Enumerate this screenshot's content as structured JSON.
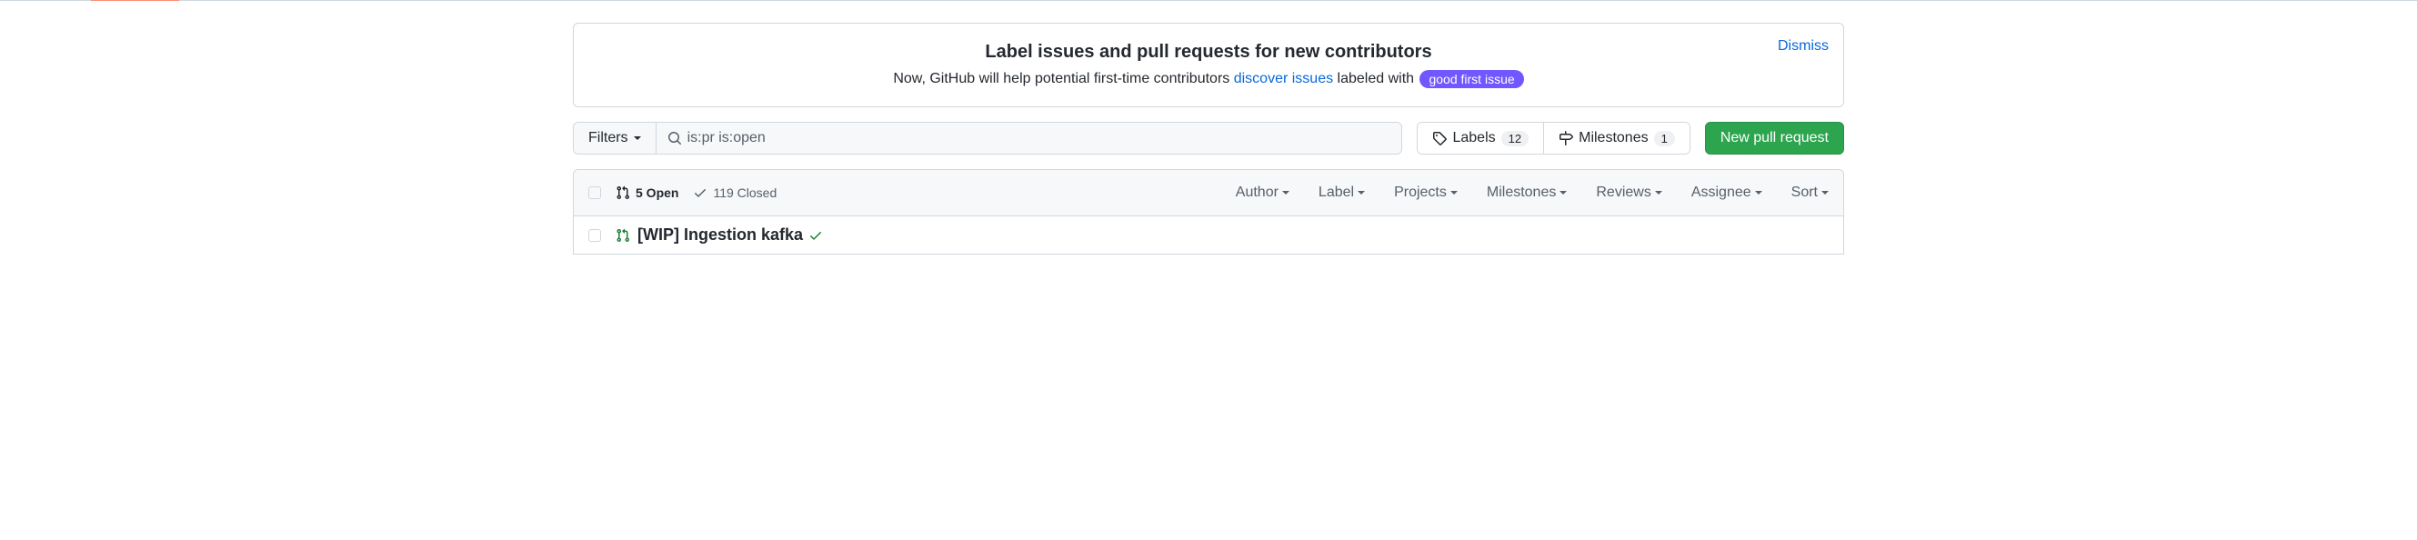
{
  "banner": {
    "title": "Label issues and pull requests for new contributors",
    "text_before": "Now, GitHub will help potential first-time contributors ",
    "link_text": "discover issues",
    "text_after": " labeled with ",
    "badge": "good first issue",
    "dismiss": "Dismiss"
  },
  "toolbar": {
    "filters_label": "Filters",
    "search_value": "is:pr is:open",
    "labels_label": "Labels",
    "labels_count": "12",
    "milestones_label": "Milestones",
    "milestones_count": "1",
    "new_pr": "New pull request"
  },
  "list_header": {
    "open_state": "5 Open",
    "closed_state": "119 Closed",
    "filters": [
      "Author",
      "Label",
      "Projects",
      "Milestones",
      "Reviews",
      "Assignee",
      "Sort"
    ]
  },
  "rows": [
    {
      "title": "[WIP] Ingestion kafka",
      "status": "success"
    }
  ]
}
